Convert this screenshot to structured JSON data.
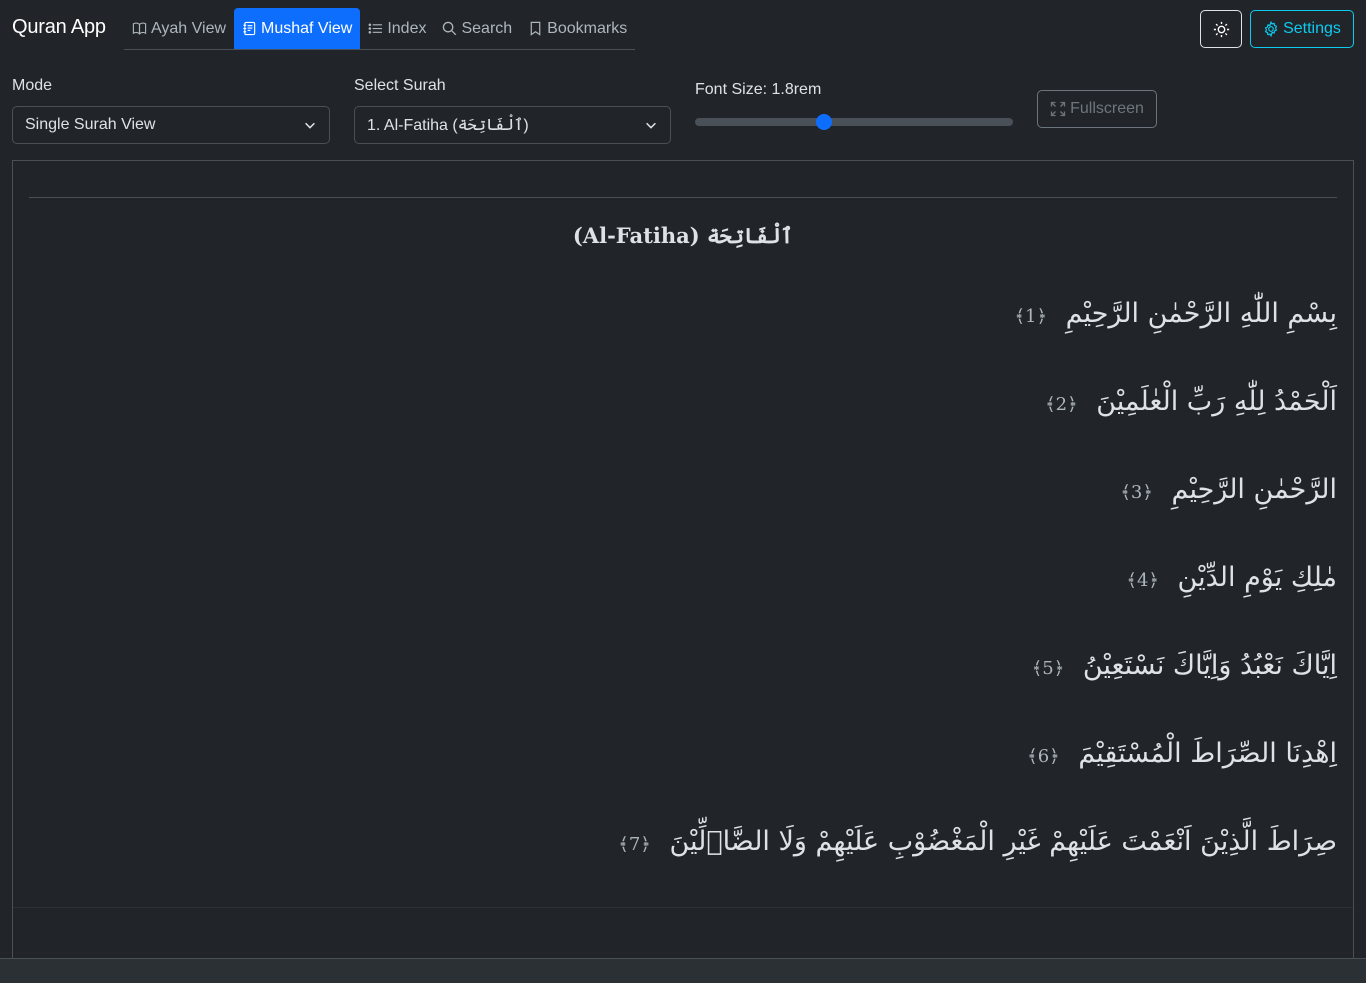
{
  "app": {
    "title": "Quran App"
  },
  "nav": {
    "tabs": [
      {
        "label": "Ayah View",
        "icon": "book-icon",
        "active": false
      },
      {
        "label": "Mushaf View",
        "icon": "journal-icon",
        "active": true
      },
      {
        "label": "Index",
        "icon": "list-icon",
        "active": false
      },
      {
        "label": "Search",
        "icon": "search-icon",
        "active": false
      },
      {
        "label": "Bookmarks",
        "icon": "bookmark-icon",
        "active": false
      }
    ]
  },
  "header": {
    "theme_icon": "sun-icon",
    "settings_label": "Settings"
  },
  "controls": {
    "mode": {
      "label": "Mode",
      "value": "Single Surah View"
    },
    "surah": {
      "label": "Select Surah",
      "value": "1. Al-Fatiha (ٱلْفَاتِحَة)"
    },
    "font_size": {
      "label": "Font Size: 1.8rem",
      "value_rem": 1.8,
      "min": 1,
      "max": 3,
      "fraction": 0.405
    },
    "fullscreen_label": "Fullscreen"
  },
  "mushaf": {
    "surah_title": "(Al-Fatiha) ٱلْفَاتِحَة",
    "ayahs": [
      {
        "text": "بِسْمِ اللّٰهِ الرَّحْمٰنِ الرَّحِيْمِ",
        "number": "﴿1﴾"
      },
      {
        "text": "اَلْحَمْدُ لِلّٰهِ رَبِّ الْعٰلَمِيْنَ",
        "number": "﴿2﴾"
      },
      {
        "text": "الرَّحْمٰنِ الرَّحِيْمِ",
        "number": "﴿3﴾"
      },
      {
        "text": "مٰلِكِ يَوْمِ الدِّيْنِ",
        "number": "﴿4﴾"
      },
      {
        "text": "اِيَّاكَ نَعْبُدُ وَاِيَّاكَ نَسْتَعِيْنُ",
        "number": "﴿5﴾"
      },
      {
        "text": "اِهْدِنَا الصِّرَاطَ الْمُسْتَقِيْمَ",
        "number": "﴿6﴾"
      },
      {
        "text": "صِرَاطَ الَّذِيْنَ اَنْعَمْتَ عَلَيْهِمْ غَيْرِ الْمَغْضُوْبِ عَلَيْهِمْ وَلَا الضَّاۤلِّيْنَ",
        "number": "﴿7﴾"
      }
    ]
  },
  "colors": {
    "accent": "#0d6efd",
    "info": "#0dcaf0",
    "background": "#212529"
  }
}
